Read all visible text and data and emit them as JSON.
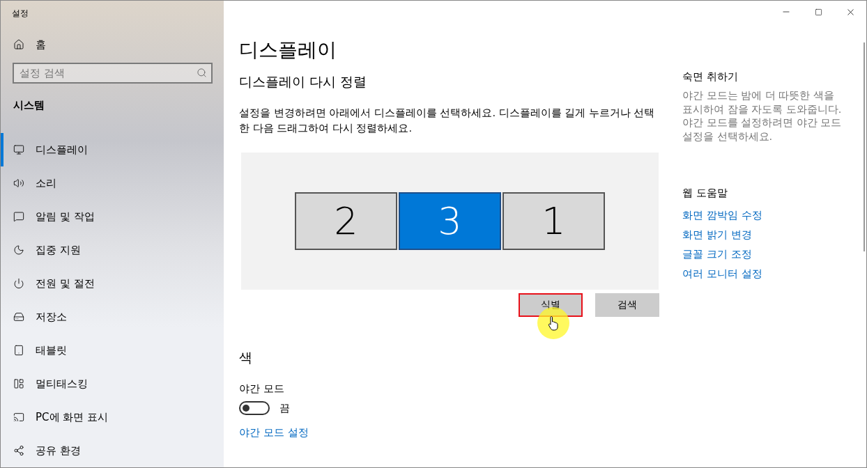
{
  "window": {
    "title": "설정"
  },
  "sidebar": {
    "home": "홈",
    "search": {
      "placeholder": "설정 검색"
    },
    "section": "시스템",
    "items": [
      {
        "label": "디스플레이",
        "selected": true
      },
      {
        "label": "소리",
        "selected": false
      },
      {
        "label": "알림 및 작업",
        "selected": false
      },
      {
        "label": "집중 지원",
        "selected": false
      },
      {
        "label": "전원 및 절전",
        "selected": false
      },
      {
        "label": "저장소",
        "selected": false
      },
      {
        "label": "태블릿",
        "selected": false
      },
      {
        "label": "멀티태스킹",
        "selected": false
      },
      {
        "label": "PC에 화면 표시",
        "selected": false
      },
      {
        "label": "공유 환경",
        "selected": false
      }
    ]
  },
  "main": {
    "title": "디스플레이",
    "subtitle": "디스플레이 다시 정렬",
    "description": "설정을 변경하려면 아래에서 디스플레이를 선택하세요. 디스플레이를 길게 누르거나 선택한 다음 드래그하여 다시 정렬하세요.",
    "monitors": [
      {
        "label": "2",
        "selected": false
      },
      {
        "label": "3",
        "selected": true
      },
      {
        "label": "1",
        "selected": false
      }
    ],
    "buttons": [
      {
        "label": "식별",
        "highlighted": true
      },
      {
        "label": "검색",
        "highlighted": false
      }
    ],
    "color_section": "색",
    "night_light": {
      "label": "야간 모드",
      "on": false,
      "state": "끔"
    },
    "night_link": "야간 모드 설정"
  },
  "aside": {
    "title": "숙면 취하기",
    "text": "야간 모드는 밤에 더 따뜻한 색을 표시하여 잠을 자도록 도와줍니다. 야간 모드를 설정하려면 야간 모드 설정을 선택하세요.",
    "help_title": "웹 도움말",
    "links": [
      "화면 깜박임 수정",
      "화면 밝기 변경",
      "글꼴 크기 조정",
      "여러 모니터 설정"
    ]
  }
}
